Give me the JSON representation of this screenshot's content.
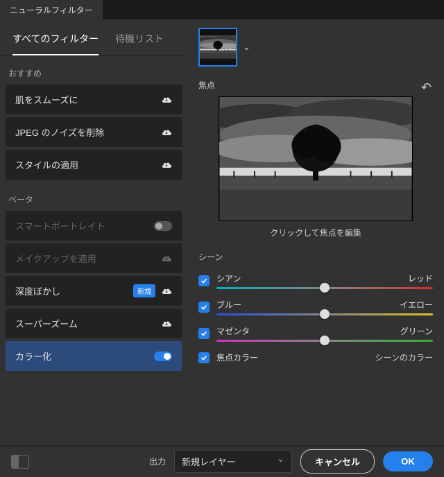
{
  "window": {
    "title": "ニューラルフィルター"
  },
  "subtabs": {
    "all": "すべてのフィルター",
    "wait": "待機リスト"
  },
  "sections": {
    "recommended": "おすすめ",
    "beta": "ベータ"
  },
  "filters": {
    "smooth_skin": "肌をスムーズに",
    "jpeg_noise": "JPEG のノイズを削除",
    "style": "スタイルの適用",
    "smart_portrait": "スマートポートレイト",
    "makeup": "メイクアップを適用",
    "depth_blur": "深度ぼかし",
    "super_zoom": "スーパーズーム",
    "colorize": "カラー化",
    "new_badge": "新規"
  },
  "main": {
    "focus_label": "焦点",
    "focus_caption": "クリックして焦点を編集",
    "scene_label": "シーン"
  },
  "sliders": {
    "cyan": "シアン",
    "red": "レッド",
    "blue": "ブルー",
    "yellow": "イエロー",
    "magenta": "マゼンタ",
    "green": "グリーン",
    "focal_color": "焦点カラー",
    "scene_color": "シーンのカラー"
  },
  "footer": {
    "output_label": "出力",
    "output_value": "新規レイヤー",
    "cancel": "キャンセル",
    "ok": "OK"
  }
}
